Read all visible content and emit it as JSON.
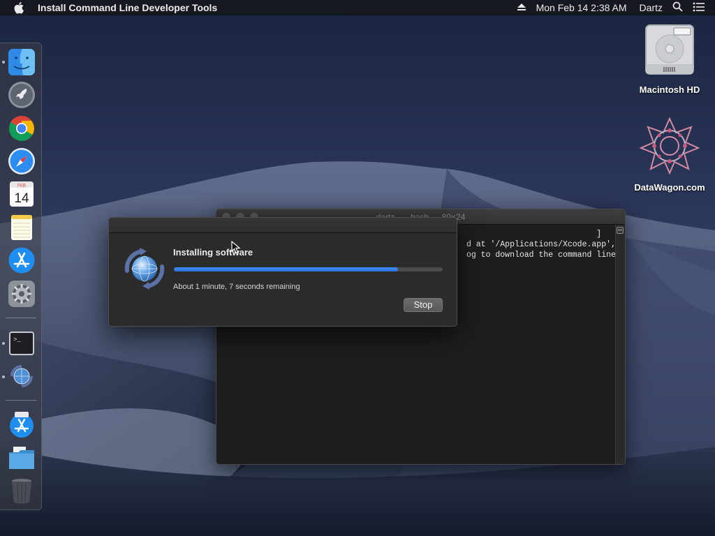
{
  "menubar": {
    "app_title": "Install Command Line Developer Tools",
    "clock": "Mon Feb 14  2:38 AM",
    "user": "Dartz"
  },
  "dock": {
    "items": [
      {
        "name": "Finder",
        "icon": "finder-icon",
        "running": true
      },
      {
        "name": "Launchpad",
        "icon": "launchpad-icon",
        "running": false
      },
      {
        "name": "Google Chrome",
        "icon": "chrome-icon",
        "running": false
      },
      {
        "name": "Safari",
        "icon": "safari-icon",
        "running": false
      },
      {
        "name": "Calendar",
        "icon": "calendar-icon",
        "running": false,
        "month": "FEB",
        "day": "14"
      },
      {
        "name": "Notes",
        "icon": "notes-icon",
        "running": false
      },
      {
        "name": "App Store",
        "icon": "app-store-icon",
        "running": false
      },
      {
        "name": "System Preferences",
        "icon": "gear-icon",
        "running": false
      },
      {
        "name": "Terminal",
        "icon": "terminal-icon",
        "running": true,
        "prompt": ">_"
      },
      {
        "name": "Install Command Line Developer Tools",
        "icon": "software-update-icon",
        "running": true
      },
      {
        "name": "App Store",
        "icon": "app-store-icon",
        "running": false
      },
      {
        "name": "Downloads",
        "icon": "folder-icon",
        "running": false
      },
      {
        "name": "Trash",
        "icon": "trash-icon",
        "running": false
      }
    ]
  },
  "desktop": {
    "icons": [
      {
        "label": "Macintosh HD",
        "icon": "hard-drive-icon"
      },
      {
        "label": "DataWagon.com",
        "icon": "datawagon-logo-icon"
      }
    ]
  },
  "terminal": {
    "title": "dartz — -bash — 80×24",
    "lines": [
      "                                                                              ]",
      "                                                   d at '/Applications/Xcode.app',",
      "                                                   og to download the command line"
    ]
  },
  "installer": {
    "heading": "Installing software",
    "progress": 0.835,
    "status": "About 1 minute, 7 seconds remaining",
    "stop_label": "Stop"
  },
  "colors": {
    "progress_fill": "#2e72d8",
    "menubar_bg": "#16181e",
    "dialog_bg": "#2b2b2c"
  }
}
